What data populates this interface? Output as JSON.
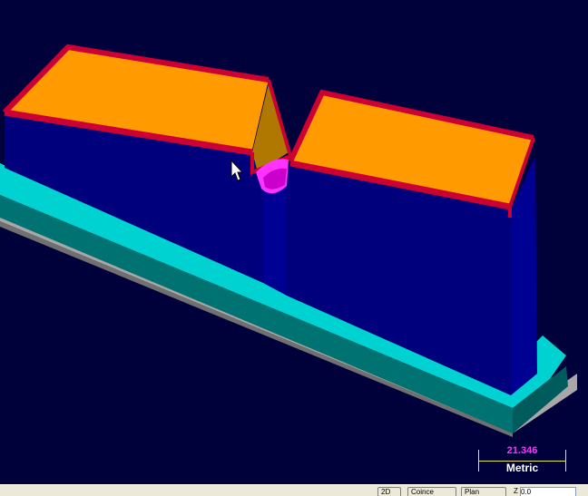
{
  "scale_bar": {
    "value": "21.346",
    "unit": "Metric",
    "value_color": "#ff33ff",
    "line_color": "#e8e85a"
  },
  "status_bar": {
    "buttons": [
      {
        "id": "b1",
        "label": "2D"
      },
      {
        "id": "b2",
        "label": "Coince"
      },
      {
        "id": "b3",
        "label": "Plan"
      }
    ],
    "z_label": "Z",
    "z_value": "0.0"
  },
  "scene": {
    "background": "#00003a",
    "colors": {
      "base_gray": "#a8a8a8",
      "base_gray_side": "#707070",
      "plate_teal": "#00d2d2",
      "plate_teal_side": "#007272",
      "body_blue": "#00007c",
      "body_blue_side": "#000092",
      "top_orange": "#ff9b00",
      "edge_red": "#cc0033",
      "notch_brown": "#b07800",
      "notch_magenta": "#ff33ff"
    }
  }
}
